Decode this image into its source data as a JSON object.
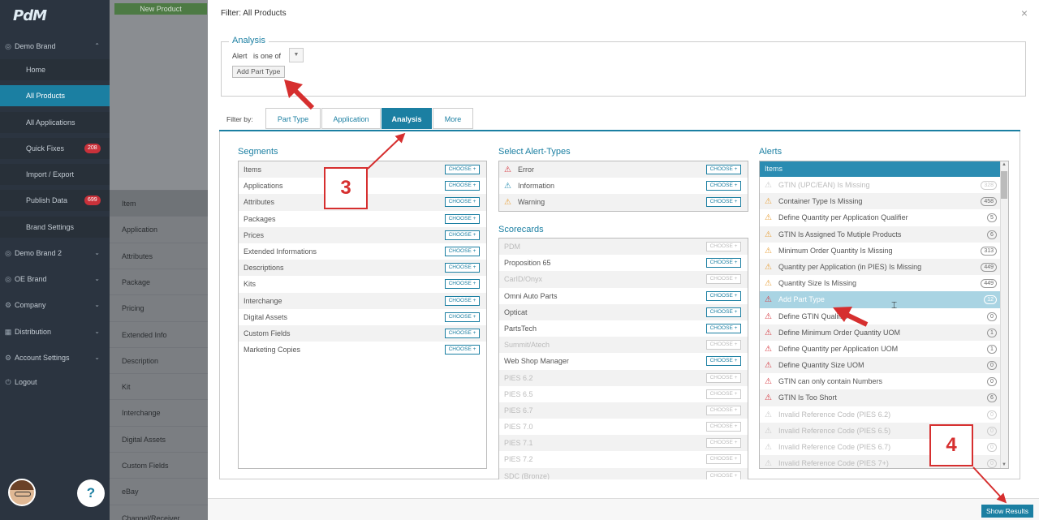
{
  "sidebar": {
    "logo": "PdM",
    "items": [
      {
        "label": "Demo Brand",
        "icon": "brand-icon",
        "type": "top",
        "chevron": "up"
      },
      {
        "label": "Home",
        "type": "sub"
      },
      {
        "label": "All Products",
        "type": "sub",
        "active": true
      },
      {
        "label": "All Applications",
        "type": "sub"
      },
      {
        "label": "Quick Fixes",
        "type": "sub",
        "badge": "208"
      },
      {
        "label": "Import / Export",
        "type": "sub"
      },
      {
        "label": "Publish Data",
        "type": "sub",
        "badge": "699"
      },
      {
        "label": "Brand Settings",
        "type": "sub"
      },
      {
        "label": "Demo Brand 2",
        "icon": "brand-icon",
        "type": "top",
        "chevron": "down"
      },
      {
        "label": "OE Brand",
        "icon": "brand-icon",
        "type": "top",
        "chevron": "down"
      },
      {
        "label": "Company",
        "icon": "gear-icon",
        "type": "top",
        "chevron": "down"
      },
      {
        "label": "Distribution",
        "icon": "grid-icon",
        "type": "top",
        "chevron": "down"
      },
      {
        "label": "Account Settings",
        "icon": "gear-icon",
        "type": "top",
        "chevron": "down"
      },
      {
        "label": "Logout",
        "icon": "power-icon",
        "type": "top"
      }
    ],
    "help": "?"
  },
  "background": {
    "new_product": "New Product",
    "items": [
      "Item",
      "Application",
      "Attributes",
      "Package",
      "Pricing",
      "Extended Info",
      "Description",
      "Kit",
      "Interchange",
      "Digital Assets",
      "Custom Fields",
      "eBay",
      "Channel/Receiver"
    ]
  },
  "modal": {
    "title": "Filter: All Products",
    "close": "×",
    "analysis": {
      "legend": "Analysis",
      "alert_label": "Alert",
      "operator": "is one of",
      "dropdown_arrow": "▼",
      "add_part_type": "Add Part Type"
    },
    "filter_by": "Filter by:",
    "tabs": [
      "Part Type",
      "Application",
      "Analysis",
      "More"
    ],
    "active_tab": "Analysis",
    "choose_label": "CHOOSE +",
    "segments": {
      "title": "Segments",
      "items": [
        "Items",
        "Applications",
        "Attributes",
        "Packages",
        "Prices",
        "Extended Informations",
        "Descriptions",
        "Kits",
        "Interchange",
        "Digital Assets",
        "Custom Fields",
        "Marketing Copies"
      ]
    },
    "alert_types": {
      "title": "Select Alert-Types",
      "items": [
        {
          "label": "Error",
          "icon": "error-icon"
        },
        {
          "label": "Information",
          "icon": "info-icon"
        },
        {
          "label": "Warning",
          "icon": "warning-icon"
        }
      ]
    },
    "scorecards": {
      "title": "Scorecards",
      "items": [
        {
          "label": "PDM",
          "enabled": false
        },
        {
          "label": "Proposition 65",
          "enabled": true
        },
        {
          "label": "CarID/Onyx",
          "enabled": false
        },
        {
          "label": "Omni Auto Parts",
          "enabled": true
        },
        {
          "label": "Opticat",
          "enabled": true
        },
        {
          "label": "PartsTech",
          "enabled": true
        },
        {
          "label": "Summit/Atech",
          "enabled": false
        },
        {
          "label": "Web Shop Manager",
          "enabled": true
        },
        {
          "label": "PIES 6.2",
          "enabled": false
        },
        {
          "label": "PIES 6.5",
          "enabled": false
        },
        {
          "label": "PIES 6.7",
          "enabled": false
        },
        {
          "label": "PIES 7.0",
          "enabled": false
        },
        {
          "label": "PIES 7.1",
          "enabled": false
        },
        {
          "label": "PIES 7.2",
          "enabled": false
        },
        {
          "label": "SDC (Bronze)",
          "enabled": false
        }
      ]
    },
    "alerts": {
      "title": "Alerts",
      "group": "Items",
      "items": [
        {
          "label": "GTIN (UPC/EAN) Is Missing",
          "count": "328",
          "icon": "warning-icon",
          "enabled": false
        },
        {
          "label": "Container Type Is Missing",
          "count": "458",
          "icon": "warning-icon",
          "enabled": true
        },
        {
          "label": "Define Quantity per Application Qualifier",
          "count": "5",
          "icon": "warning-icon",
          "enabled": true
        },
        {
          "label": "GTIN Is Assigned To Mutiple Products",
          "count": "6",
          "icon": "warning-icon",
          "enabled": true
        },
        {
          "label": "Minimum Order Quantity Is Missing",
          "count": "313",
          "icon": "warning-icon",
          "enabled": true
        },
        {
          "label": "Quantity per Application (in PIES) Is Missing",
          "count": "449",
          "icon": "warning-icon",
          "enabled": true
        },
        {
          "label": "Quantity Size Is Missing",
          "count": "449",
          "icon": "warning-icon",
          "enabled": true
        },
        {
          "label": "Add Part Type",
          "count": "12",
          "icon": "error-icon",
          "enabled": true,
          "selected": true
        },
        {
          "label": "Define GTIN Qualifier",
          "count": "0",
          "icon": "error-icon",
          "enabled": true
        },
        {
          "label": "Define Minimum Order Quantity UOM",
          "count": "1",
          "icon": "error-icon",
          "enabled": true
        },
        {
          "label": "Define Quantity per Application UOM",
          "count": "1",
          "icon": "error-icon",
          "enabled": true
        },
        {
          "label": "Define Quantity Size UOM",
          "count": "0",
          "icon": "error-icon",
          "enabled": true
        },
        {
          "label": "GTIN can only contain Numbers",
          "count": "0",
          "icon": "error-icon",
          "enabled": true
        },
        {
          "label": "GTIN Is Too Short",
          "count": "6",
          "icon": "error-icon",
          "enabled": true
        },
        {
          "label": "Invalid Reference Code (PIES 6.2)",
          "count": "0",
          "icon": "error-icon",
          "enabled": false
        },
        {
          "label": "Invalid Reference Code (PIES 6.5)",
          "count": "0",
          "icon": "error-icon",
          "enabled": false
        },
        {
          "label": "Invalid Reference Code (PIES 6.7)",
          "count": "0",
          "icon": "error-icon",
          "enabled": false
        },
        {
          "label": "Invalid Reference Code (PIES 7+)",
          "count": "0",
          "icon": "error-icon",
          "enabled": false
        }
      ]
    },
    "show_results": "Show Results"
  },
  "annotations": {
    "step3": "3",
    "step4": "4"
  },
  "colors": {
    "accent": "#1b7fa2",
    "error": "#d6373f",
    "warning": "#e8a13a",
    "annotation": "#d62f2f",
    "sidebar": "#2b3440"
  }
}
